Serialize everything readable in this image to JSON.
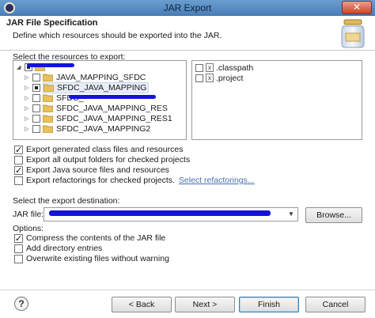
{
  "window": {
    "title": "JAR Export",
    "close_glyph": "✕"
  },
  "header": {
    "title": "JAR File Specification",
    "description": "Define which resources should be exported into the JAR."
  },
  "resources": {
    "label": "Select the resources to export:",
    "projects": [
      {
        "label": ""
      },
      {
        "label": "JAVA_MAPPING_SFDC"
      },
      {
        "label": "SFDC_JAVA_MAPPING"
      },
      {
        "label": "SFDC_"
      },
      {
        "label": "SFDC_JAVA_MAPPING_RES"
      },
      {
        "label": "SFDC_JAVA_MAPPING_RES1"
      },
      {
        "label": "SFDC_JAVA_MAPPING2"
      }
    ],
    "files": [
      {
        "label": ".classpath",
        "icon": "x-file-icon"
      },
      {
        "label": ".project",
        "icon": "x-file-icon"
      }
    ]
  },
  "export_options": [
    {
      "label": "Export generated class files and resources",
      "checked": true
    },
    {
      "label": "Export all output folders for checked projects",
      "checked": false
    },
    {
      "label": "Export Java source files and resources",
      "checked": true
    },
    {
      "label": "Export refactorings for checked projects.",
      "checked": false,
      "link": "Select refactorings..."
    }
  ],
  "destination": {
    "label": "Select the export destination:",
    "jar_file_label": "JAR file:",
    "jar_file_value": "",
    "browse_label": "Browse..."
  },
  "options": {
    "label": "Options:",
    "items": [
      {
        "label": "Compress the contents of the JAR file",
        "checked": true
      },
      {
        "label": "Add directory entries",
        "checked": false
      },
      {
        "label": "Overwrite existing files without warning",
        "checked": false
      }
    ]
  },
  "footer": {
    "help": "?",
    "back": "< Back",
    "next": "Next >",
    "finish": "Finish",
    "cancel": "Cancel"
  },
  "colors": {
    "redaction": "#1414d8",
    "link": "#4a6fb0",
    "titlebar": "#5a8ec4"
  }
}
